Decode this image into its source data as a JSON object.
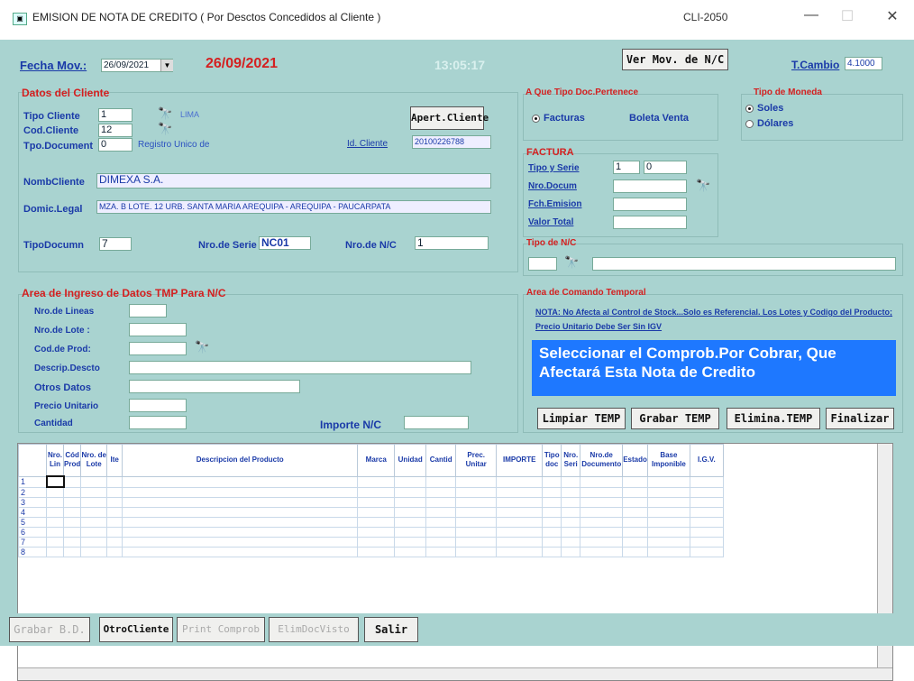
{
  "window": {
    "title": "EMISION DE NOTA DE CREDITO ( Por Desctos Concedidos al Cliente )",
    "code": "CLI-2050",
    "minimize": "—",
    "maximize": "☐",
    "close": "✕"
  },
  "header": {
    "fecha_label": "Fecha Mov.:",
    "fecha_value": "26/09/2021",
    "fecha_big": "26/09/2021",
    "time": "13:05:17",
    "ver_mov_button": "Ver Mov. de N/C",
    "tcambio_label": "T.Cambio",
    "tcambio_value": "4.1000"
  },
  "cliente": {
    "title": "Datos del Cliente",
    "tipo_cliente_label": "Tipo Cliente",
    "tipo_cliente_value": "1",
    "tipo_cliente_desc": "LIMA",
    "cod_cliente_label": "Cod.Cliente",
    "cod_cliente_value": "12",
    "tpo_documento_label": "Tpo.Document",
    "tpo_documento_value": "0",
    "tpo_documento_desc": "Registro Unico de",
    "apert_cliente_button": "Apert.Cliente",
    "id_cliente_label": "Id. Cliente",
    "id_cliente_value": "20100226788",
    "nombre_label": "NombCliente",
    "nombre_value": "DIMEXA S.A.",
    "domicilio_label": "Domic.Legal",
    "domicilio_value": "MZA. B LOTE. 12 URB. SANTA MARIA AREQUIPA - AREQUIPA - PAUCARPATA",
    "tipodoc_label": "TipoDocumn",
    "tipodoc_value": "7",
    "serie_label": "Nro.de Serie",
    "serie_value": "NC01",
    "nronc_label": "Nro.de N/C",
    "nronc_value": "1"
  },
  "tipo_doc": {
    "title": "A Que Tipo Doc.Pertenece",
    "opt_facturas": "Facturas",
    "opt_boleta": "Boleta Venta"
  },
  "moneda": {
    "title": "Tipo de Moneda",
    "opt_soles": "Soles",
    "opt_dolares": "Dólares"
  },
  "factura": {
    "title": "FACTURA",
    "tipo_serie_label": "Tipo y Serie",
    "tipo_value": "1",
    "serie_value": "0",
    "nro_docum_label": "Nro.Docum",
    "fch_emision_label": "Fch.Emision",
    "valor_total_label": "Valor Total"
  },
  "tipo_nc": {
    "title": "Tipo de N/C"
  },
  "ingreso": {
    "title": "Area de Ingreso de Datos TMP Para N/C",
    "nro_lineas": "Nro.de Lineas",
    "nro_lote": "Nro.de Lote :",
    "cod_prod": "Cod.de Prod:",
    "descrip": "Descrip.Descto",
    "otros": "Otros Datos",
    "precio": "Precio Unitario",
    "cantidad": "Cantidad",
    "importe": "Importe N/C"
  },
  "comando": {
    "title": "Area de Comando Temporal",
    "nota": "NOTA: No Afecta al Control de Stock...Solo es Referencial. Los Lotes y Codigo del Producto; Precio Unitario Debe Ser Sin IGV",
    "message": "Seleccionar el Comprob.Por Cobrar, Que Afectará Esta Nota de Credito",
    "btn_limpiar": "Limpiar TEMP",
    "btn_grabar": "Grabar TEMP",
    "btn_elimina": "Elimina.TEMP",
    "btn_finalizar": "Finalizar"
  },
  "grid": {
    "columns": [
      "Nro. Lin",
      "Cód Prod",
      "Nro. de Lote",
      "Ite",
      "Descripcion del Producto",
      "Marca",
      "Unidad",
      "Cantid",
      "Prec. Unitar",
      "IMPORTE",
      "Tipo doc",
      "Nro. Seri",
      "Nro.de Documento",
      "Estado",
      "Base Imponible",
      "I.G.V."
    ],
    "rows": [
      "1",
      "2",
      "3",
      "4",
      "5",
      "6",
      "7",
      "8"
    ]
  },
  "footer": {
    "btn_grabar_bd": "Grabar B.D.",
    "btn_otro_cliente": "OtroCliente",
    "btn_print": "Print Comprob",
    "btn_elimdoc": "ElimDocVisto",
    "btn_salir": "Salir"
  }
}
